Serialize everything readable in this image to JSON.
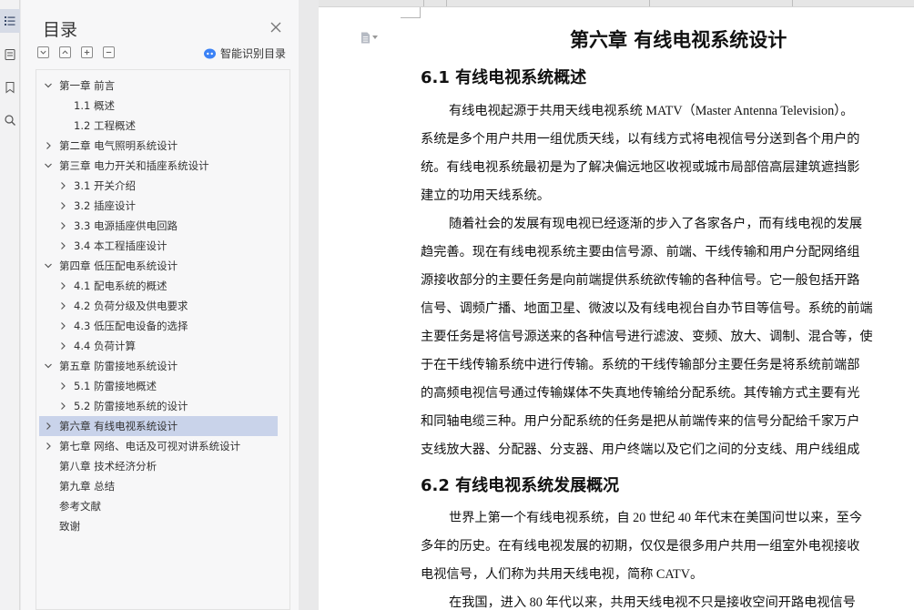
{
  "toc_panel": {
    "title": "目录",
    "smart_label": "智能识别目录",
    "items": [
      {
        "label": "第一章  前言",
        "level": 0,
        "expanded": true
      },
      {
        "label": "1.1  概述",
        "level": 1,
        "leaf": true
      },
      {
        "label": "1.2  工程概述",
        "level": 1,
        "leaf": true
      },
      {
        "label": "第二章  电气照明系统设计",
        "level": 0,
        "expanded": false
      },
      {
        "label": "第三章  电力开关和插座系统设计",
        "level": 0,
        "expanded": true
      },
      {
        "label": "3.1  开关介绍",
        "level": 1,
        "expanded": false
      },
      {
        "label": "3.2  插座设计",
        "level": 1,
        "expanded": false
      },
      {
        "label": "3.3  电源插座供电回路",
        "level": 1,
        "expanded": false
      },
      {
        "label": "3.4  本工程插座设计",
        "level": 1,
        "expanded": false
      },
      {
        "label": "第四章  低压配电系统设计",
        "level": 0,
        "expanded": true
      },
      {
        "label": "4.1  配电系统的概述",
        "level": 1,
        "expanded": false
      },
      {
        "label": "4.2  负荷分级及供电要求",
        "level": 1,
        "expanded": false
      },
      {
        "label": "4.3  低压配电设备的选择",
        "level": 1,
        "expanded": false
      },
      {
        "label": "4.4  负荷计算",
        "level": 1,
        "expanded": false
      },
      {
        "label": "第五章  防雷接地系统设计",
        "level": 0,
        "expanded": true
      },
      {
        "label": "5.1  防雷接地概述",
        "level": 1,
        "expanded": false
      },
      {
        "label": "5.2  防雷接地系统的设计",
        "level": 1,
        "expanded": false
      },
      {
        "label": "第六章  有线电视系统设计",
        "level": 0,
        "expanded": false,
        "selected": true
      },
      {
        "label": "第七章  网络、电话及可视对讲系统设计",
        "level": 0,
        "expanded": false
      },
      {
        "label": "第八章  技术经济分析",
        "level": 0,
        "leaf": true
      },
      {
        "label": "第九章  总结",
        "level": 0,
        "leaf": true
      },
      {
        "label": "参考文献",
        "level": 0,
        "leaf": true
      },
      {
        "label": "致谢",
        "level": 0,
        "leaf": true
      }
    ]
  },
  "document": {
    "chapter_title": "第六章  有线电视系统设计",
    "section1_title": "6.1  有线电视系统概述",
    "section1_lines": [
      "有线电视起源于共用天线电视系统 MATV（Master Antenna Television）。",
      "系统是多个用户共用一组优质天线，以有线方式将电视信号分送到各个用户的",
      "统。有线电视系统最初是为了解决偏远地区收视或城市局部倍高层建筑遮挡影",
      "建立的功用天线系统。",
      "随着社会的发展有现电视已经逐渐的步入了各家各户，而有线电视的发展",
      "趋完善。现在有线电视系统主要由信号源、前端、干线传输和用户分配网络组",
      "源接收部分的主要任务是向前端提供系统欲传输的各种信号。它一般包括开路",
      "信号、调频广播、地面卫星、微波以及有线电视台自办节目等信号。系统的前端",
      "主要任务是将信号源送来的各种信号进行滤波、变频、放大、调制、混合等，使",
      "于在干线传输系统中进行传输。系统的干线传输部分主要任务是将系统前端部",
      "的高频电视信号通过传输媒体不失真地传输给分配系统。其传输方式主要有光",
      "和同轴电缆三种。用户分配系统的任务是把从前端传来的信号分配给千家万户",
      "支线放大器、分配器、分支器、用户终端以及它们之间的分支线、用户线组成"
    ],
    "section2_title": "6.2  有线电视系统发展概况",
    "section2_lines": [
      "世界上第一个有线电视系统，自 20 世纪 40 年代末在美国问世以来，至今",
      "多年的历史。在有线电视发展的初期，仅仅是很多用户共用一组室外电视接收",
      "电视信号，人们称为共用天线电视，简称 CATV。",
      "在我国，进入 80 年代以来，共用天线电视不只是接收空间开路电视信号"
    ]
  }
}
